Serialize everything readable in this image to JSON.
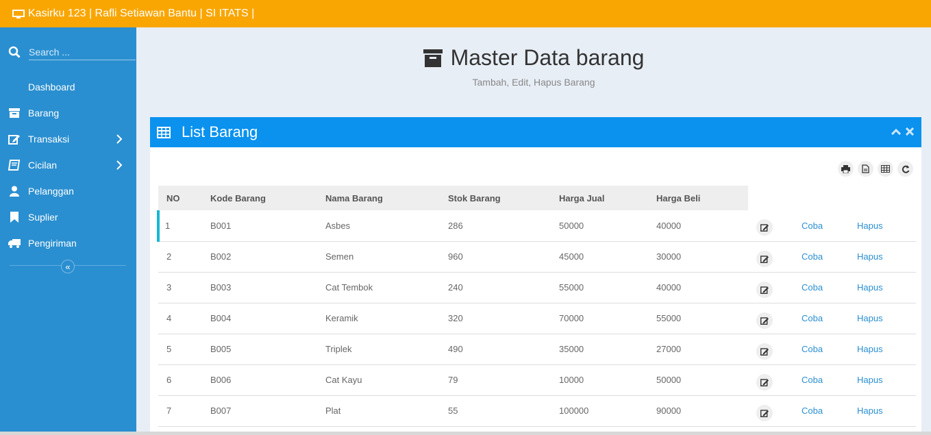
{
  "topbar": {
    "title": "Kasirku 123 | Rafli Setiawan Bantu | SI ITATS |",
    "icon": "monitor-icon"
  },
  "sidebar": {
    "search_placeholder": "Search ...",
    "items": [
      {
        "label": "Dashboard",
        "icon": ""
      },
      {
        "label": "Barang",
        "icon": "archive-icon"
      },
      {
        "label": "Transaksi",
        "icon": "edit-icon",
        "submenu": true
      },
      {
        "label": "Cicilan",
        "icon": "book-icon",
        "submenu": true
      },
      {
        "label": "Pelanggan",
        "icon": "user-icon"
      },
      {
        "label": "Suplier",
        "icon": "bookmark-icon"
      },
      {
        "label": "Pengiriman",
        "icon": "truck-icon"
      }
    ],
    "collapse_label": "«"
  },
  "header": {
    "title": "Master Data barang",
    "subtitle": "Tambah, Edit, Hapus Barang"
  },
  "panel": {
    "title": "List Barang",
    "columns": [
      "NO",
      "Kode Barang",
      "Nama Barang",
      "Stok Barang",
      "Harga Jual",
      "Harga Beli"
    ],
    "rows": [
      {
        "no": "1",
        "kode": "B001",
        "nama": "Asbes",
        "stok": "286",
        "jual": "50000",
        "beli": "40000",
        "coba": "Coba",
        "hapus": "Hapus"
      },
      {
        "no": "2",
        "kode": "B002",
        "nama": "Semen",
        "stok": "960",
        "jual": "45000",
        "beli": "30000",
        "coba": "Coba",
        "hapus": "Hapus"
      },
      {
        "no": "3",
        "kode": "B003",
        "nama": "Cat Tembok",
        "stok": "240",
        "jual": "55000",
        "beli": "40000",
        "coba": "Coba",
        "hapus": "Hapus"
      },
      {
        "no": "4",
        "kode": "B004",
        "nama": "Keramik",
        "stok": "320",
        "jual": "70000",
        "beli": "55000",
        "coba": "Coba",
        "hapus": "Hapus"
      },
      {
        "no": "5",
        "kode": "B005",
        "nama": "Triplek",
        "stok": "490",
        "jual": "35000",
        "beli": "27000",
        "coba": "Coba",
        "hapus": "Hapus"
      },
      {
        "no": "6",
        "kode": "B006",
        "nama": "Cat Kayu",
        "stok": "79",
        "jual": "10000",
        "beli": "50000",
        "coba": "Coba",
        "hapus": "Hapus"
      },
      {
        "no": "7",
        "kode": "B007",
        "nama": "Plat",
        "stok": "55",
        "jual": "100000",
        "beli": "90000",
        "coba": "Coba",
        "hapus": "Hapus"
      }
    ]
  },
  "colors": {
    "topbar": "#f9a602",
    "sidebar": "#2a8fd0",
    "panel_header": "#0a92ee",
    "link": "#2a8fd0",
    "active_row_marker": "#17b6d4"
  }
}
